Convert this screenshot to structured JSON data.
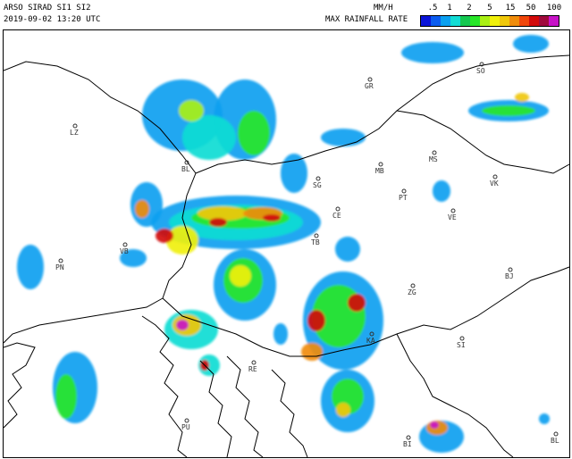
{
  "header": {
    "title": "ARSO SIRAD SI1 SI2",
    "timestamp": "2019-09-02 13:20 UTC",
    "unit": "MM/H",
    "legend_title": "MAX RAINFALL RATE"
  },
  "legend": {
    "tick_labels": [
      ".5",
      "1",
      "2",
      "5",
      "15",
      "50",
      "100"
    ],
    "colors": [
      "#0a14d8",
      "#0a5cf0",
      "#0aa0f0",
      "#12dcd4",
      "#14c850",
      "#28e628",
      "#aaf014",
      "#f0f00a",
      "#f0c80a",
      "#f08c0a",
      "#f0460a",
      "#d20a0a",
      "#a00a3c",
      "#c814c8"
    ]
  },
  "map": {
    "cities": [
      {
        "code": "GR"
      },
      {
        "code": "SO"
      },
      {
        "code": "LZ"
      },
      {
        "code": "BL"
      },
      {
        "code": "MB"
      },
      {
        "code": "MS"
      },
      {
        "code": "VK"
      },
      {
        "code": "SG"
      },
      {
        "code": "PT"
      },
      {
        "code": "CE"
      },
      {
        "code": "VE"
      },
      {
        "code": "TB"
      },
      {
        "code": "VB"
      },
      {
        "code": "PN"
      },
      {
        "code": "ZG"
      },
      {
        "code": "BJ"
      },
      {
        "code": "KA"
      },
      {
        "code": "SI"
      },
      {
        "code": "RE"
      },
      {
        "code": "PU"
      },
      {
        "code": "BI"
      },
      {
        "code": "BL"
      }
    ],
    "colors": {
      "border": "#000000",
      "coast": "#000000",
      "city": "#333333"
    }
  }
}
